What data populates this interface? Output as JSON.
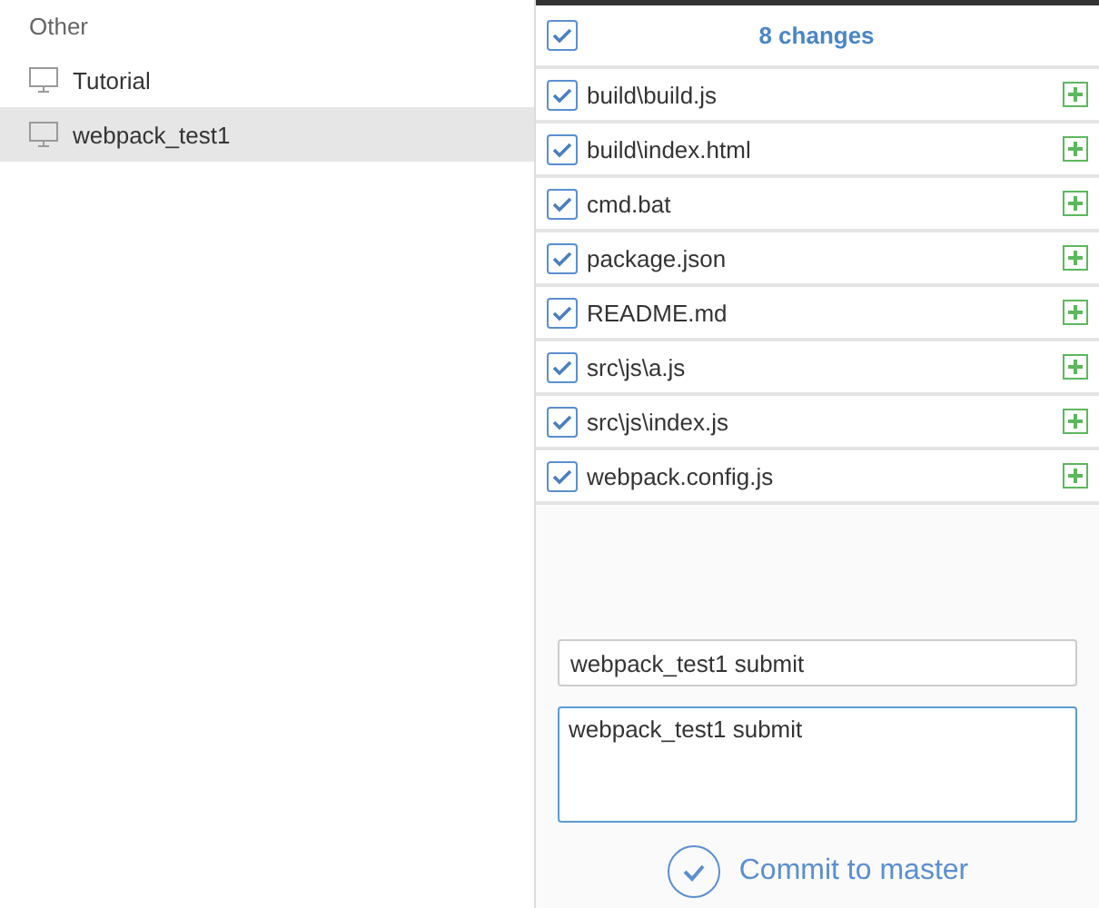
{
  "sidebar": {
    "group": "Other",
    "items": [
      {
        "label": "Tutorial",
        "selected": false
      },
      {
        "label": "webpack_test1",
        "selected": true
      }
    ]
  },
  "changes": {
    "header": {
      "label": "8 changes",
      "checked": true
    },
    "files": [
      {
        "path": "build\\build.js",
        "checked": true
      },
      {
        "path": "build\\index.html",
        "checked": true
      },
      {
        "path": "cmd.bat",
        "checked": true
      },
      {
        "path": "package.json",
        "checked": true
      },
      {
        "path": "README.md",
        "checked": true
      },
      {
        "path": "src\\js\\a.js",
        "checked": true
      },
      {
        "path": "src\\js\\index.js",
        "checked": true
      },
      {
        "path": "webpack.config.js",
        "checked": true
      }
    ]
  },
  "commit": {
    "summary": "webpack_test1 submit",
    "description": "webpack_test1 submit",
    "button": "Commit to master"
  }
}
